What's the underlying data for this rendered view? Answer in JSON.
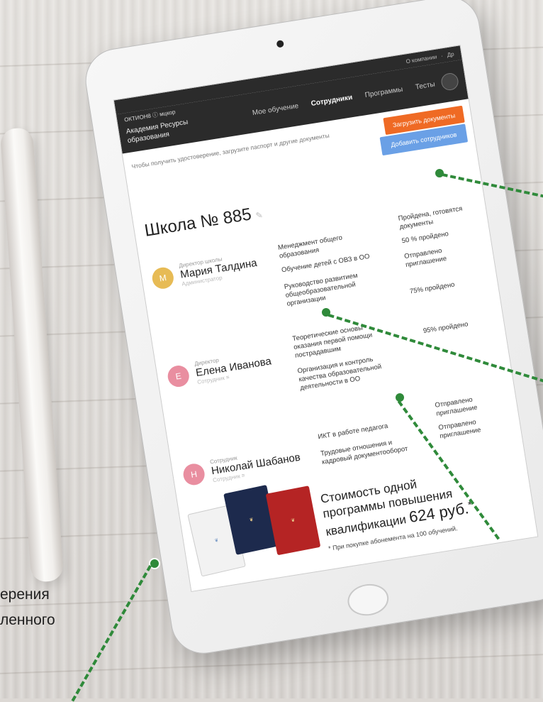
{
  "app": {
    "brand": "ОКТИОН8 ⓘ мцкор"
  },
  "topnav": {
    "links": [
      "О компании",
      "Др"
    ]
  },
  "header": {
    "org": "Академия Ресурсы образования",
    "nav": [
      "Мое обучение",
      "Сотрудники",
      "Программы",
      "Тесты"
    ]
  },
  "notice": {
    "text": "Чтобы получить удостоверение, загрузите паспорт и другие документы",
    "upload_button": "Загрузить документы",
    "add_button": "Добавить сотрудников"
  },
  "school": {
    "title": "Школа № 885"
  },
  "staff": [
    {
      "initial": "М",
      "role": "Директор школы",
      "name": "Мария Талдина",
      "sub": "Администратор",
      "color": "#e7bb55",
      "programs": [
        "Менеджмент общего образования",
        "Обучение детей с ОВЗ в ОО",
        "Руководство развитием общеобразовательной организации"
      ],
      "statuses": [
        "Пройдена, готовятся документы",
        "50 % пройдено",
        "Отправлено приглашение",
        "75% пройдено"
      ]
    },
    {
      "initial": "Е",
      "role": "Директор",
      "name": "Елена Иванова",
      "sub": "Сотрудник ≡",
      "color": "#e98ea0",
      "programs": [
        "Теоретические основы оказания первой помощи пострадавшим",
        "Организация и контроль качества образовательной деятельности в ОО"
      ],
      "statuses": [
        "95% пройдено"
      ]
    },
    {
      "initial": "Н",
      "role": "Сотрудник",
      "name": "Николай Шабанов",
      "sub": "Сотрудник ≡",
      "color": "#e98ea0",
      "programs": [
        "ИКТ в работе педагога",
        "Трудовые отношения и кадровый документооборот"
      ],
      "statuses": [
        "Отправлено приглашение",
        "Отправлено приглашение"
      ]
    }
  ],
  "price": {
    "line1": "Стоимость одной",
    "line2": "программы повышения",
    "line3": "квалификации",
    "amount": "624 руб.",
    "asterisk": "*",
    "note": "* При покупке абонемента на 100 обучений."
  },
  "side_text": {
    "line1": "ерения",
    "line2": "ленного"
  },
  "colors": {
    "accent_orange": "#ef6a24",
    "accent_blue": "#6aa0e6",
    "annotation_green": "#2f8a3a"
  }
}
